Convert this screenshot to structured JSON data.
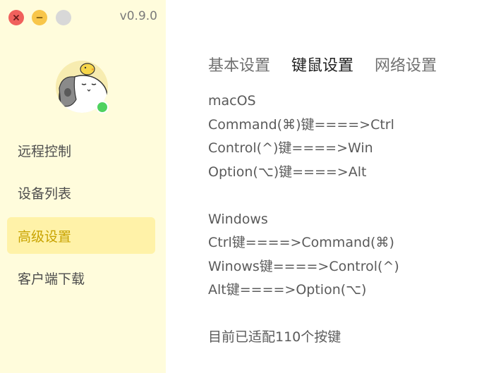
{
  "window": {
    "version": "v0.9.0"
  },
  "sidebar": {
    "items": [
      {
        "label": "远程控制",
        "active": false
      },
      {
        "label": "设备列表",
        "active": false
      },
      {
        "label": "高级设置",
        "active": true
      },
      {
        "label": "客户端下载",
        "active": false
      }
    ]
  },
  "main": {
    "tabs": [
      {
        "label": "基本设置",
        "active": false
      },
      {
        "label": "键鼠设置",
        "active": true
      },
      {
        "label": "网络设置",
        "active": false
      }
    ],
    "mac_section": {
      "title": "macOS",
      "lines": [
        "Command(⌘)键====>Ctrl",
        "Control(^)键====>Win",
        "Option(⌥)键====>Alt"
      ]
    },
    "win_section": {
      "title": "Windows",
      "lines": [
        "Ctrl键====>Command(⌘)",
        "Winows键====>Control(^)",
        "Alt键====>Option(⌥)"
      ]
    },
    "footer_note": "目前已适配110个按键"
  },
  "colors": {
    "sidebar_bg": "#fffcdc",
    "active_item_bg": "#fff2a8",
    "active_item_text": "#c8a300",
    "online_status": "#4fd25f"
  }
}
